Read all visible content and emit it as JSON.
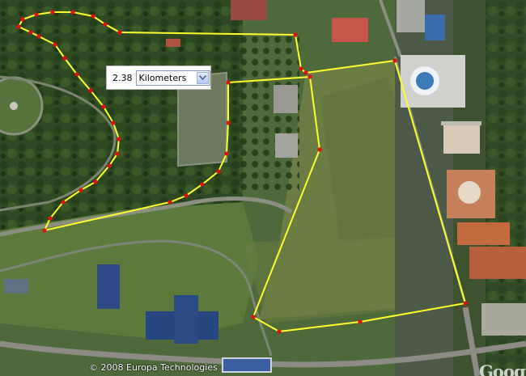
{
  "measure": {
    "value": "2.38",
    "unit": "Kilometers"
  },
  "attribution": {
    "copyright": "© 2008 Europa Technologies",
    "logo": "Goog"
  },
  "colors": {
    "path": "#ffff2e",
    "vertex": "#e01010"
  },
  "icons": {
    "dropdown": "chevron-down-icon"
  }
}
